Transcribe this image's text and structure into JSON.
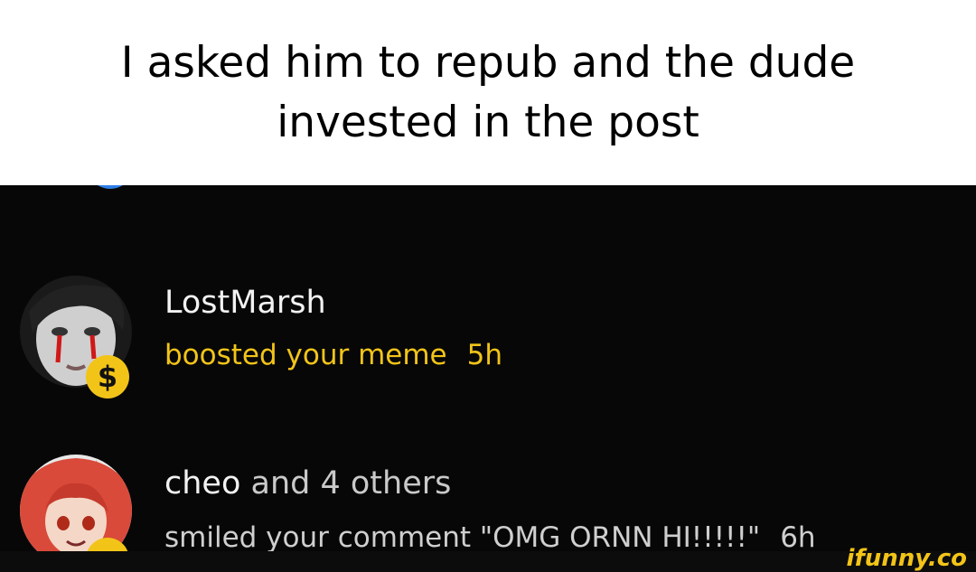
{
  "caption": {
    "line1": "I asked him to repub and the dude",
    "line2": "invested in the post"
  },
  "notifications": [
    {
      "user": "LostMarsh",
      "action": "boosted your meme",
      "time": "5h",
      "badge": "$",
      "badge_icon": "dollar-badge-icon",
      "action_color": "#f2c418"
    },
    {
      "user": "cheo",
      "user_suffix": "and 4 others",
      "action": "smiled your comment \"OMG ORNN HI!!!!!\"",
      "time": "6h",
      "badge_icon": "smile-badge-icon",
      "action_color": "#cfcfcf"
    }
  ],
  "watermark": "ifunny.co",
  "colors": {
    "caption_bg": "#ffffff",
    "feed_bg": "#070707",
    "accent_yellow": "#f2c418",
    "partial_badge_blue": "#2f7fe6"
  }
}
